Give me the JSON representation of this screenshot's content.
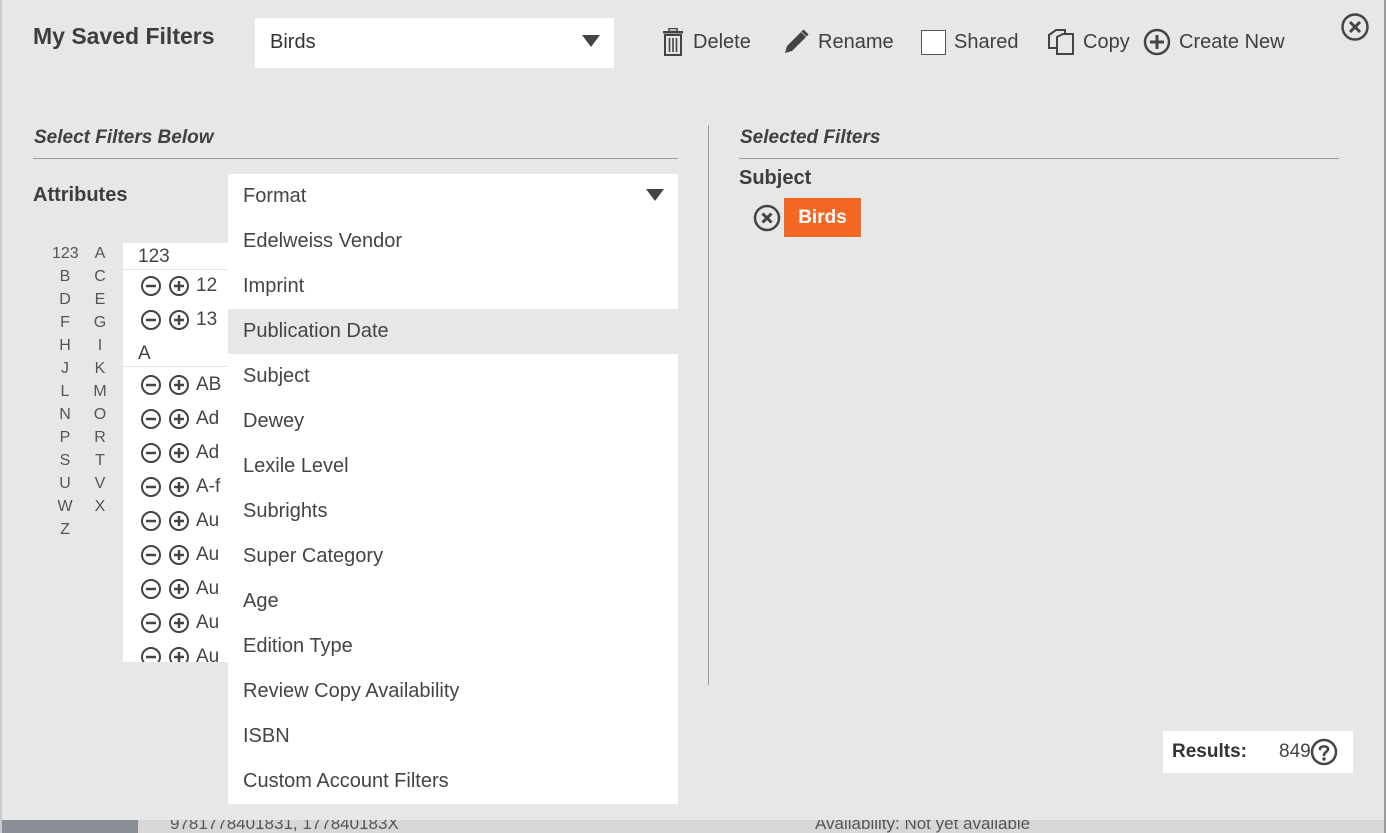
{
  "header": {
    "title": "My Saved Filters",
    "selected_filter": "Birds",
    "tools": {
      "delete": "Delete",
      "rename": "Rename",
      "shared": "Shared",
      "copy": "Copy",
      "create_new": "Create New"
    }
  },
  "left": {
    "section_title": "Select Filters Below",
    "attributes_label": "Attributes",
    "attribute_selected": "Format",
    "alpha_index": [
      "123",
      "A",
      "B",
      "C",
      "D",
      "E",
      "F",
      "G",
      "H",
      "I",
      "J",
      "K",
      "L",
      "M",
      "N",
      "O",
      "P",
      "R",
      "S",
      "T",
      "U",
      "V",
      "W",
      "X",
      "Z"
    ],
    "value_groups": [
      {
        "header": "123",
        "rows": [
          "12",
          "13"
        ]
      },
      {
        "header": "A",
        "rows": [
          "AB",
          "Ad",
          "Ad",
          "A-f",
          "Au",
          "Au",
          "Au",
          "Au",
          "Au"
        ]
      }
    ],
    "dropdown_options": [
      "Edelweiss Vendor",
      "Imprint",
      "Publication Date",
      "Subject",
      "Dewey",
      "Lexile Level",
      "Subrights",
      "Super Category",
      "Age",
      "Edition Type",
      "Review Copy Availability",
      "ISBN",
      "Custom Account Filters"
    ],
    "highlighted_option": "Publication Date"
  },
  "right": {
    "section_title": "Selected Filters",
    "groups": [
      {
        "label": "Subject",
        "chips": [
          "Birds"
        ]
      }
    ]
  },
  "results": {
    "label": "Results:",
    "count": "849"
  },
  "background": {
    "isbn_text": "9781778401831, 177840183X",
    "availability_text": "Availability: Not yet available"
  },
  "colors": {
    "chip": "#f26722",
    "modal_bg": "#e6e7e8"
  }
}
